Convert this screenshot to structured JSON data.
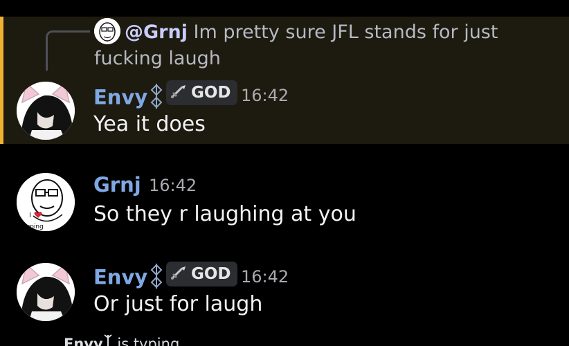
{
  "reply": {
    "mention": "@Grnj",
    "text": " Im pretty sure JFL stands for just fucking laugh"
  },
  "messages": [
    {
      "author": "Envy",
      "role_badge": "GOD",
      "time": "16:42",
      "text": "Yea it does",
      "highlighted": true
    },
    {
      "author": "Grnj",
      "time": "16:42",
      "text": "So they r laughing at you"
    },
    {
      "author": "Envy",
      "role_badge": "GOD",
      "time": "16:42",
      "text": "Or just for laugh"
    }
  ],
  "typing": {
    "user": "Envy",
    "suffix": " is typing..."
  },
  "colors": {
    "background": "#000000",
    "highlight_bg": "#1d1a10",
    "highlight_bar": "#f0b232",
    "username": "#7fa8e3",
    "mention": "#c9cdfb",
    "timestamp": "#a9abb0"
  },
  "icons": {
    "username_symbol": "runic-symbol-icon",
    "badge_icon": "sword-icon"
  }
}
